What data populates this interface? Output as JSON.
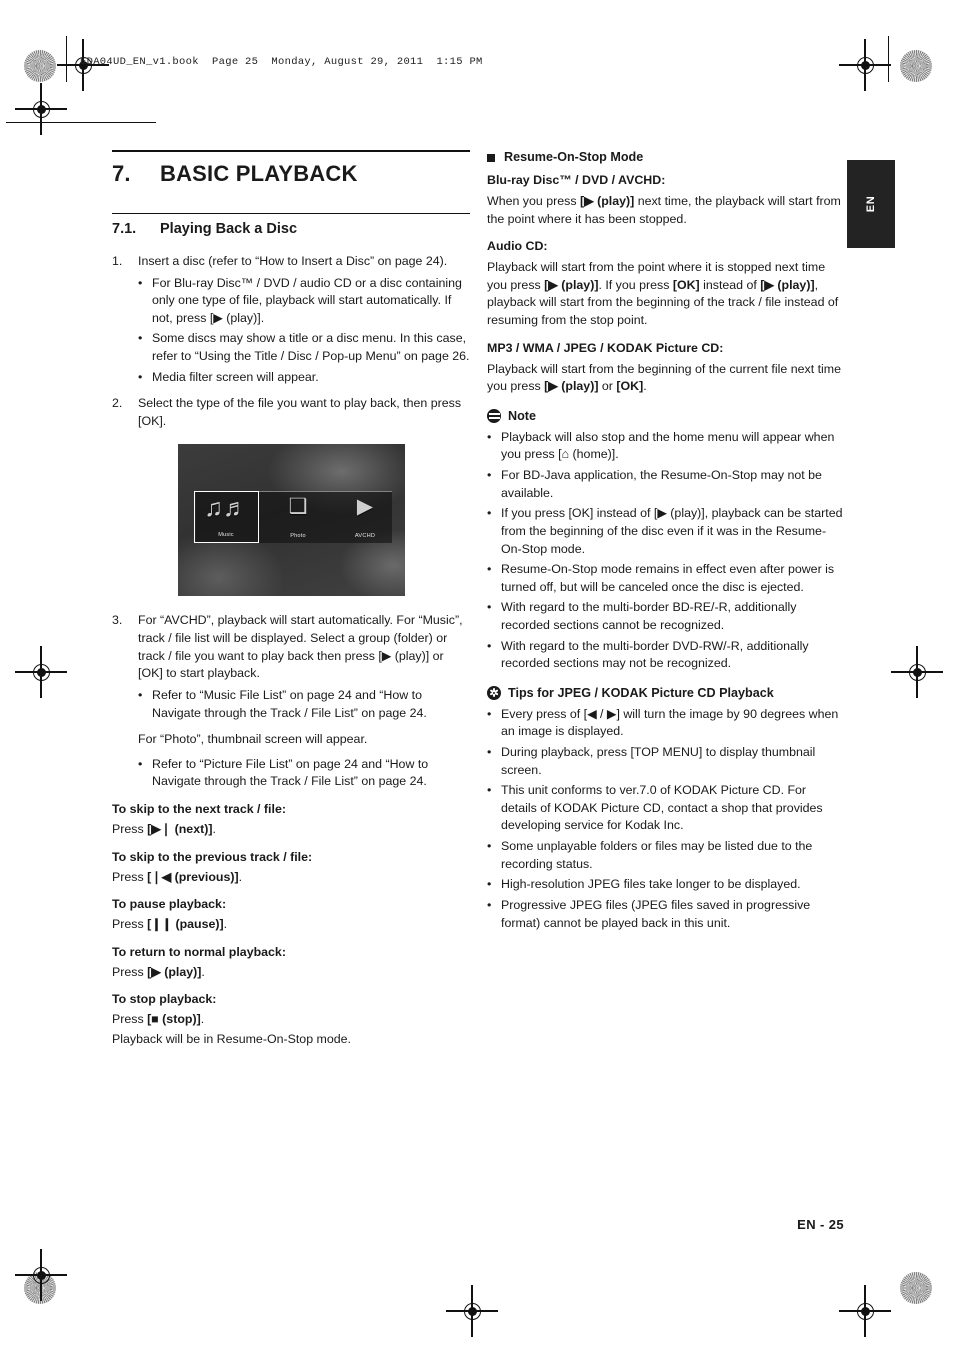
{
  "print_header": "EDA04UD_EN_v1.book  Page 25  Monday, August 29, 2011  1:15 PM",
  "side_tab": {
    "label": "EN"
  },
  "footer": {
    "page_label": "EN - 25"
  },
  "chapter": {
    "number": "7.",
    "title": "BASIC PLAYBACK"
  },
  "section": {
    "number": "7.1.",
    "title": "Playing Back a Disc"
  },
  "left_column": {
    "steps": [
      {
        "number": "1.",
        "text": "Insert a disc (refer to “How to Insert a Disc” on page 24).",
        "bullets": [
          "For Blu-ray Disc™ / DVD / audio CD or a disc containing only one type of file, playback will start automatically. If not, press [▶ (play)].",
          "Some discs may show a title or a disc menu. In this case, refer to “Using the Title / Disc / Pop-up Menu” on page 26.",
          "Media filter screen will appear."
        ]
      },
      {
        "number": "2.",
        "text": "Select the type of the file you want to play back, then press [OK].",
        "bullets": []
      },
      {
        "number": "3.",
        "text": "For “AVCHD”, playback will start automatically. For “Music”, track / file list will be displayed. Select a group (folder) or track / file you want to play back then press [▶ (play)] or [OK] to start playback.",
        "bullets": [
          "Refer to “Music File List” on page 24 and “How to Navigate through the Track / File List” on page 24."
        ]
      }
    ],
    "figure": {
      "name": "media-filter-screen",
      "tiles": [
        {
          "label": "Music",
          "icon": "music-notes-icon",
          "glyph": "♫♬",
          "selected": true
        },
        {
          "label": "Photo",
          "icon": "photo-frame-icon",
          "glyph": "❑",
          "selected": false
        },
        {
          "label": "AVCHD",
          "icon": "camcorder-icon",
          "glyph": "▶",
          "selected": false
        }
      ]
    },
    "photo_note": "For “Photo”, thumbnail screen will appear.",
    "photo_bullet": "Refer to “Picture File List” on page 24 and “How to Navigate through the Track / File List” on page 24.",
    "operations": [
      {
        "heading": "To skip to the next track / file:",
        "press_prefix": "Press ",
        "key": "[▶❘ (next)]",
        "press_suffix": "."
      },
      {
        "heading": "To skip to the previous track / file:",
        "press_prefix": "Press ",
        "key": "[❘◀ (previous)]",
        "press_suffix": "."
      },
      {
        "heading": "To pause playback:",
        "press_prefix": "Press ",
        "key": "[❙❙ (pause)]",
        "press_suffix": "."
      },
      {
        "heading": "To return to normal playback:",
        "press_prefix": "Press ",
        "key": "[▶ (play)]",
        "press_suffix": "."
      },
      {
        "heading": "To stop playback:",
        "press_prefix": "Press ",
        "key": "[■ (stop)]",
        "press_suffix": ".",
        "extra": "Playback will be in Resume-On-Stop mode."
      }
    ]
  },
  "right_column": {
    "block_title": "Resume-On-Stop Mode",
    "groups": [
      {
        "heading": "Blu-ray Disc™ / DVD / AVCHD:",
        "body_1": "When you press ",
        "key_1": "[▶ (play)]",
        "body_2": " next time, the playback will start from the point where it has been stopped."
      },
      {
        "heading": "Audio CD:",
        "body_1": "Playback will start from the point where it is stopped next time you press ",
        "key_1": "[▶ (play)]",
        "body_2": ". If you press ",
        "key_2": "[OK]",
        "body_3": " instead of ",
        "key_3": "[▶ (play)]",
        "body_4": ", playback will start from the beginning of the track / file instead of resuming from the stop point."
      },
      {
        "heading": "MP3 / WMA / JPEG / KODAK Picture CD:",
        "body_1": "Playback will start from the beginning of the current file next time you press ",
        "key_1": "[▶ (play)]",
        "body_2": " or ",
        "key_2": "[OK]",
        "body_3": "."
      }
    ],
    "note": {
      "icon": "note-icon",
      "title": "Note",
      "bullets": [
        "Playback will also stop and the home menu will appear when you press [⌂ (home)].",
        "For BD-Java application, the Resume-On-Stop may not be available.",
        "If you press [OK] instead of [▶ (play)], playback can be started from the beginning of the disc even if it was in the Resume-On-Stop mode.",
        "Resume-On-Stop mode remains in effect even after power is turned off, but will be canceled once the disc is ejected.",
        "With regard to the multi-border BD-RE/-R, additionally recorded sections cannot be recognized.",
        "With regard to the multi-border DVD-RW/-R, additionally recorded sections may not be recognized."
      ]
    },
    "tips": {
      "icon": "tips-icon",
      "title": "Tips for JPEG / KODAK Picture CD Playback",
      "bullets": [
        "Every press of [◀ / ▶] will turn the image by 90 degrees when an image is displayed.",
        "During playback, press [TOP MENU] to display thumbnail screen.",
        "This unit conforms to ver.7.0 of KODAK Picture CD. For details of KODAK Picture CD, contact a shop that provides developing service for Kodak Inc.",
        "Some unplayable folders or files may be listed due to the recording status.",
        "High-resolution JPEG files take longer to be displayed.",
        "Progressive JPEG files (JPEG files saved in progressive format) cannot be played back in this unit."
      ]
    }
  }
}
